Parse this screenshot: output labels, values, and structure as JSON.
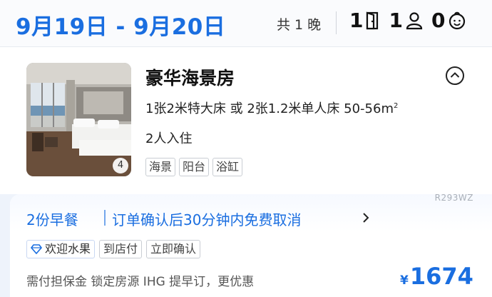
{
  "header": {
    "date_range": "9月19日 - 9月20日",
    "nights": "共 1 晚",
    "rooms": "1",
    "adults": "1",
    "children": "0"
  },
  "room": {
    "name": "豪华海景房",
    "photo_count": "4",
    "bed_info": "1张2米特大床 或 2张1.2米单人床  50-56m",
    "area_unit_sup": "2",
    "occupancy": "2人入住",
    "tags": [
      "海景",
      "阳台",
      "浴缸"
    ]
  },
  "rate": {
    "code": "R293WZ",
    "breakfast": "2份早餐",
    "cancel_policy": "订单确认后30分钟内免费取消",
    "perks": [
      "欢迎水果",
      "到店付",
      "立即确认"
    ],
    "note": "需付担保金 锁定房源 IHG 提早订，更优惠",
    "currency": "¥",
    "price": "1674"
  },
  "colors": {
    "accent": "#1a6ee0",
    "background": "#eef3fb"
  }
}
